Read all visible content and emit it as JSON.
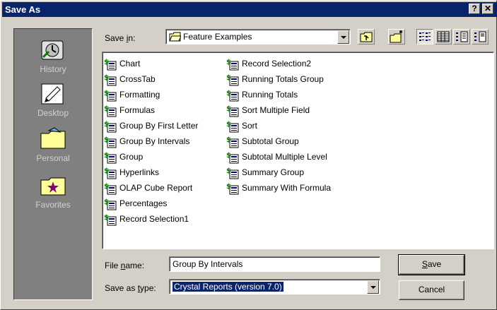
{
  "window": {
    "title": "Save As",
    "help_glyph": "?",
    "close_glyph": "✕"
  },
  "places": [
    {
      "label": "History",
      "icon": "history-icon"
    },
    {
      "label": "Desktop",
      "icon": "desktop-icon"
    },
    {
      "label": "Personal",
      "icon": "folder-icon"
    },
    {
      "label": "Favorites",
      "icon": "favorites-folder-icon"
    }
  ],
  "save_in": {
    "label_pre": "Save ",
    "label_u": "i",
    "label_post": "n:",
    "value": "Feature Examples"
  },
  "toolbar": [
    "up-one-level-icon",
    "new-folder-icon",
    "list-view-icon",
    "details-view-icon",
    "properties-view-icon",
    "preview-view-icon"
  ],
  "files": {
    "col1": [
      "Chart",
      "CrossTab",
      "Formatting",
      "Formulas",
      "Group By First Letter",
      "Group By Intervals",
      "Group",
      "Hyperlinks",
      "OLAP Cube Report",
      "Percentages",
      "Record Selection1"
    ],
    "col2": [
      "Record Selection2",
      "Running Totals Group",
      "Running Totals",
      "Sort Multiple Field",
      "Sort",
      "Subtotal Group",
      "Subtotal Multiple Level",
      "Summary Group",
      "Summary With Formula"
    ]
  },
  "file_name": {
    "label_pre": "File ",
    "label_u": "n",
    "label_post": "ame:",
    "value": "Group By Intervals"
  },
  "save_type": {
    "label_pre": "Save as ",
    "label_u": "t",
    "label_post": "ype:",
    "value": "Crystal Reports (version 7.0)"
  },
  "buttons": {
    "save_u": "S",
    "save_rest": "ave",
    "cancel": "Cancel"
  },
  "colors": {
    "titlebar": "#0a246a",
    "face": "#d4d0c8",
    "places_bg": "#808080"
  }
}
